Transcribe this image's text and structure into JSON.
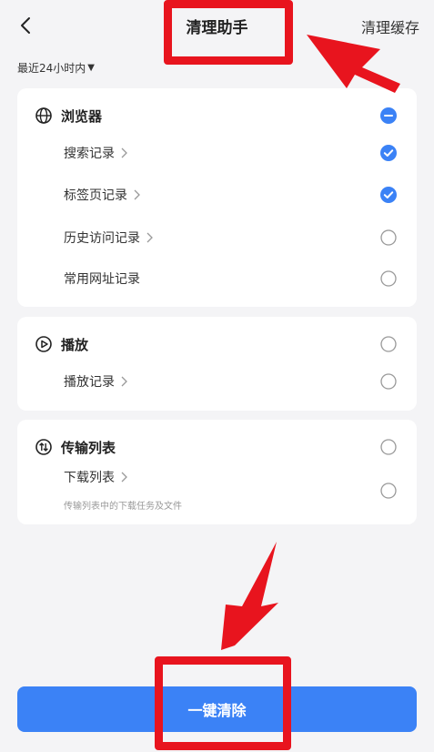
{
  "header": {
    "title": "清理助手",
    "action_label": "清理缓存"
  },
  "filter": {
    "time_range": "最近24小时内"
  },
  "groups": [
    {
      "title": "浏览器",
      "icon": "globe-icon",
      "state": "partial",
      "items": [
        {
          "label": "搜索记录",
          "has_arrow": true,
          "checked": true
        },
        {
          "label": "标签页记录",
          "has_arrow": true,
          "checked": true
        },
        {
          "label": "历史访问记录",
          "has_arrow": true,
          "checked": false
        },
        {
          "label": "常用网址记录",
          "has_arrow": false,
          "checked": false
        }
      ]
    },
    {
      "title": "播放",
      "icon": "play-circle-icon",
      "state": "unchecked",
      "items": [
        {
          "label": "播放记录",
          "has_arrow": true,
          "checked": false
        }
      ]
    },
    {
      "title": "传输列表",
      "icon": "transfer-icon",
      "state": "unchecked",
      "items": [
        {
          "label": "下载列表",
          "sublabel": "传输列表中的下载任务及文件",
          "has_arrow": true,
          "checked": false
        }
      ]
    }
  ],
  "footer": {
    "primary_label": "一键清除"
  },
  "colors": {
    "accent": "#3b82f6",
    "annotation": "#e8141e",
    "background": "#f4f4f6",
    "card": "#ffffff"
  }
}
